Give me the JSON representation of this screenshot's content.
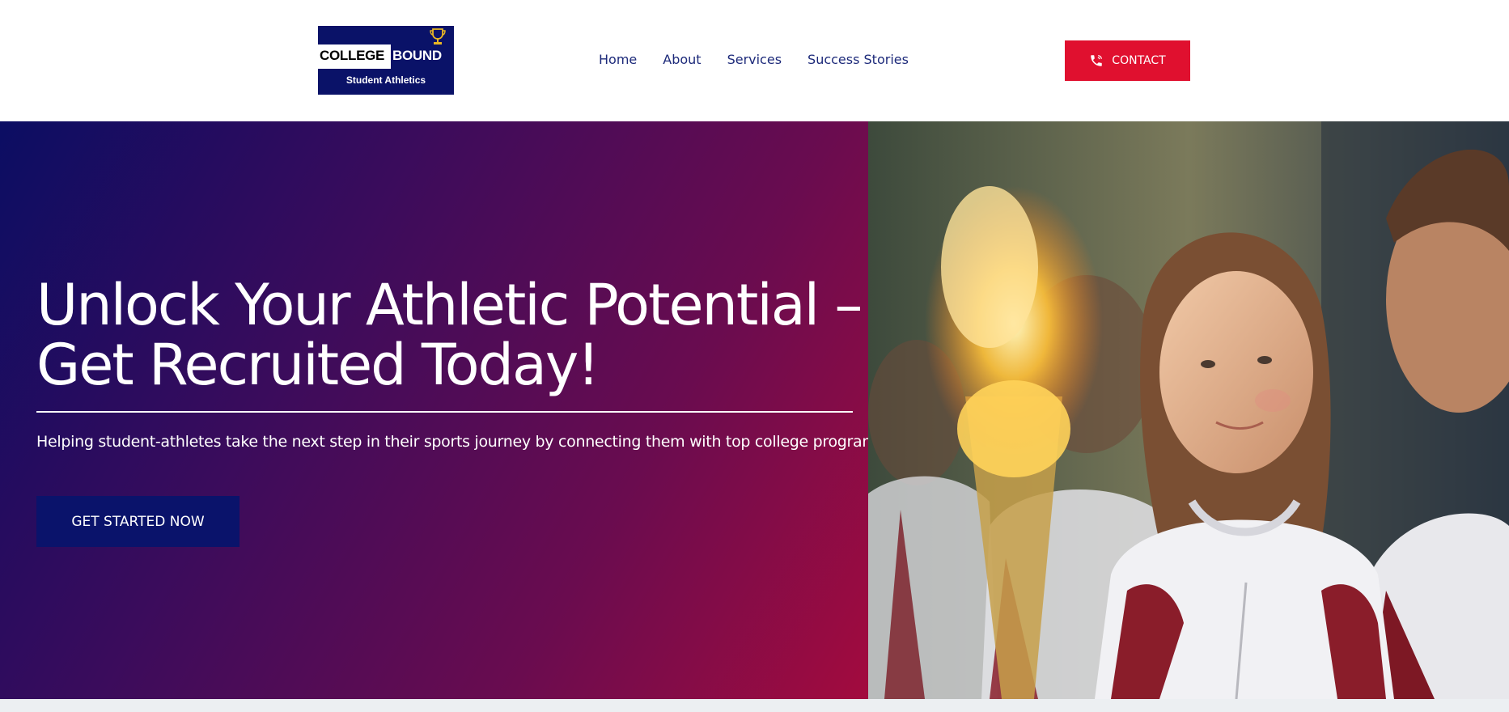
{
  "brand": {
    "logo_word1": "COLLEGE",
    "logo_word2": "BOUND",
    "logo_tagline": "Student Athletics",
    "primary_color": "#0a1268",
    "accent_color": "#e0102f"
  },
  "nav": {
    "items": [
      {
        "label": "Home"
      },
      {
        "label": "About"
      },
      {
        "label": "Services"
      },
      {
        "label": "Success Stories"
      }
    ]
  },
  "header": {
    "contact_label": "CONTACT",
    "contact_icon": "phone-icon"
  },
  "hero": {
    "title": "Unlock Your Athletic Potential – Get Recruited Today!",
    "subtitle": "Helping student-athletes take the next step in their sports journey by connecting them with top college programs.",
    "cta_label": "GET STARTED NOW",
    "gradient_start": "#0b0d63",
    "gradient_end": "#a30b3e"
  }
}
